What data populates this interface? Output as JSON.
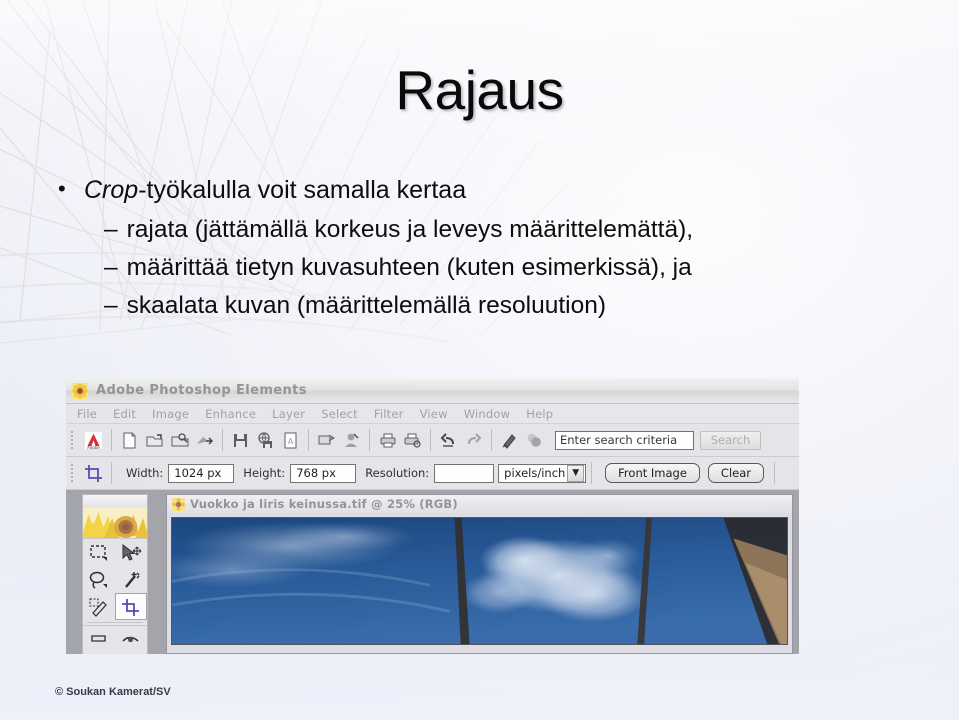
{
  "slide": {
    "title": "Rajaus",
    "bullet": {
      "lead_italic": "Crop",
      "lead_rest": "-työkalulla voit samalla kertaa",
      "marker": "•"
    },
    "sub_bullets": [
      {
        "marker": "–",
        "text": "rajata (jättämällä korkeus ja leveys määrittelemättä),"
      },
      {
        "marker": "–",
        "text": "määrittää tietyn kuvasuhteen (kuten esimerkissä), ja"
      },
      {
        "marker": "–",
        "text": "skaalata kuvan (määrittelemällä resoluution)"
      }
    ],
    "footer": "© Soukan Kamerat/SV",
    "background_color": "#eceef7",
    "title_color": "#0a0a0a"
  },
  "photoshop": {
    "app_title": "Adobe Photoshop Elements",
    "app_icon": "sunflower-icon",
    "menu_items": [
      "File",
      "Edit",
      "Image",
      "Enhance",
      "Layer",
      "Select",
      "Filter",
      "View",
      "Window",
      "Help"
    ],
    "shortcut_bar": {
      "icons": [
        "adobe-logo-icon",
        "new-file-icon",
        "open-file-icon",
        "browse-folder-icon",
        "import-icon",
        "save-icon",
        "save-for-web-icon",
        "save-as-pdf-icon",
        "online-services-icon",
        "attach-email-icon",
        "print-icon",
        "print-preview-icon",
        "undo-icon",
        "redo-icon",
        "step-backward-icon",
        "quick-fix-icon"
      ],
      "search_value": "Enter search criteria",
      "search_button": "Search"
    },
    "options_bar": {
      "tool_icon": "crop-tool-icon",
      "width_label": "Width:",
      "width_value": "1024 px",
      "height_label": "Height:",
      "height_value": "768 px",
      "resolution_label": "Resolution:",
      "resolution_value": "",
      "unit_value": "pixels/inch",
      "unit_caret": "▼",
      "front_image_button": "Front Image",
      "clear_button": "Clear"
    },
    "toolbox": {
      "banner": "sunflower-banner-image",
      "tools": [
        {
          "name": "rectangular-marquee-tool",
          "selected": false
        },
        {
          "name": "move-tool",
          "selected": false
        },
        {
          "name": "lasso-tool",
          "selected": false
        },
        {
          "name": "magic-wand-tool",
          "selected": false
        },
        {
          "name": "selection-brush-tool",
          "selected": false
        },
        {
          "name": "crop-tool",
          "selected": true
        }
      ]
    },
    "document": {
      "icon": "document-thumb-icon",
      "title": "Vuokko ja liris keinussa.tif @ 25% (RGB)",
      "image_description": "blue-sky-with-clouds-and-swing-frame-poles"
    }
  }
}
